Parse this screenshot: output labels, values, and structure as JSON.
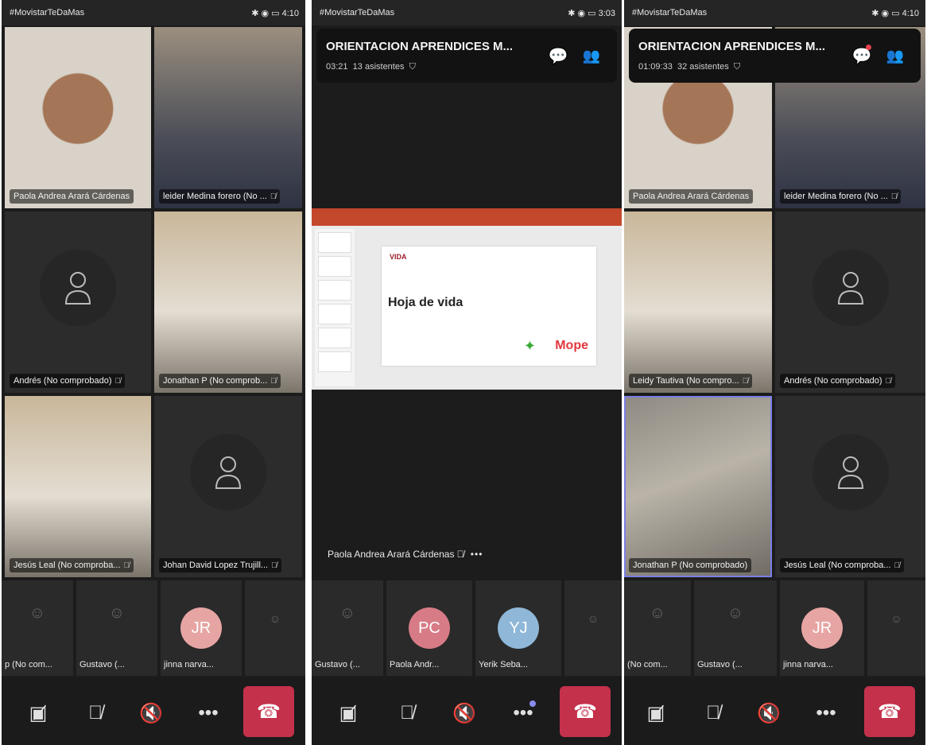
{
  "status_bar": {
    "carrier": "#MovistarTeDaMas",
    "p1_time": "4:10",
    "p2_time": "3:03",
    "p3_time": "4:10"
  },
  "phone1": {
    "tiles": [
      {
        "name": "Paola Andrea Arará Cárdenas",
        "muted": false
      },
      {
        "name": "leider Medina forero  (No ...",
        "muted": true
      },
      {
        "name": "Andrés  (No comprobado)",
        "muted": true
      },
      {
        "name": "Jonathan P (No comprob...",
        "muted": true
      },
      {
        "name": "Jesús Leal (No comproba...",
        "muted": true
      },
      {
        "name": "Johan David Lopez Trujill...",
        "muted": true
      }
    ],
    "strip": [
      {
        "label": "p (No com...",
        "initials": ""
      },
      {
        "label": "Gustavo  (...",
        "initials": ""
      },
      {
        "label": "jinna narva...",
        "initials": "JR"
      },
      {
        "label": "",
        "initials": ""
      }
    ]
  },
  "phone2": {
    "meeting_title": "ORIENTACION APRENDICES M...",
    "elapsed": "03:21",
    "attendees": "13 asistentes",
    "slide": {
      "logo": "VIDA",
      "title": "Hoja de vida",
      "brand": "Mope"
    },
    "presenter": "Paola Andrea Arará Cárdenas",
    "more": "•••",
    "strip": [
      {
        "label": "Gustavo  (...",
        "initials": ""
      },
      {
        "label": "Paola Andr...",
        "initials": "PC"
      },
      {
        "label": "Yerik Seba...",
        "initials": "YJ"
      },
      {
        "label": "",
        "initials": ""
      }
    ]
  },
  "phone3": {
    "meeting_title": "ORIENTACION APRENDICES M...",
    "elapsed": "01:09:33",
    "attendees": "32 asistentes",
    "tiles": [
      {
        "name": "Paola Andrea Arará Cárdenas",
        "muted": false
      },
      {
        "name": "leider Medina forero  (No ...",
        "muted": true
      },
      {
        "name": "Leidy Tautiva (No compro...",
        "muted": true
      },
      {
        "name": "Andrés  (No comprobado)",
        "muted": true
      },
      {
        "name": "Jonathan P (No comprobado)",
        "muted": false
      },
      {
        "name": "Jesús Leal (No comproba...",
        "muted": true
      }
    ],
    "strip": [
      {
        "label": "(No com...",
        "initials": ""
      },
      {
        "label": "Gustavo  (...",
        "initials": ""
      },
      {
        "label": "jinna narva...",
        "initials": "JR"
      },
      {
        "label": "",
        "initials": ""
      }
    ]
  },
  "controls": {
    "camera": "camera-off-icon",
    "mic": "mic-off-icon",
    "speaker": "speaker-off-icon",
    "more": "•••",
    "hangup": "hang-up-icon"
  },
  "colors": {
    "hangup": "#c4314b",
    "active_speaker": "#7b7fe6",
    "avatar_jr": "#e6a5a3",
    "avatar_pc": "#d77b86",
    "avatar_yj": "#8fb7d8",
    "notification": "#e8404d"
  }
}
